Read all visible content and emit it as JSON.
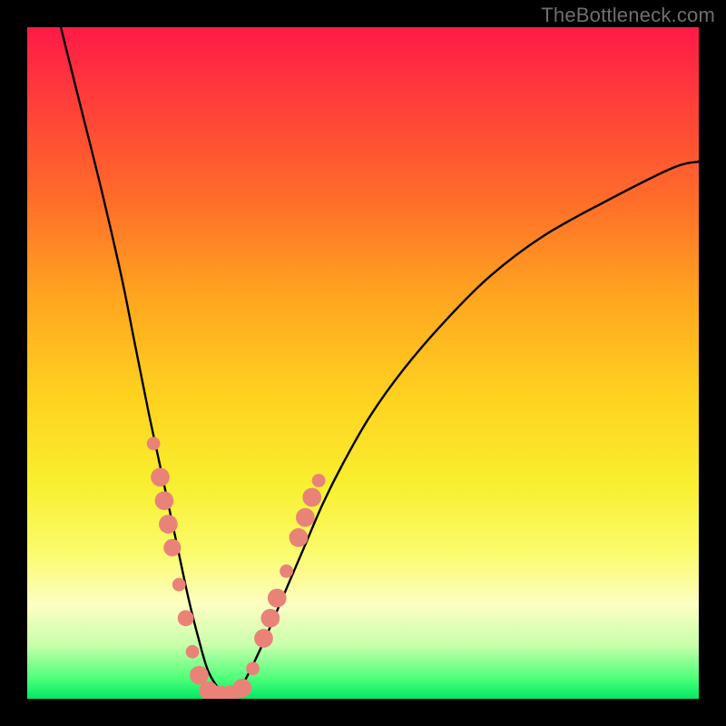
{
  "watermark": {
    "text": "TheBottleneck.com"
  },
  "colors": {
    "background": "#000000",
    "curve": "#000000",
    "marker_fill": "#e98378",
    "marker_stroke": "#cf5b4e"
  },
  "chart_data": {
    "type": "line",
    "title": "",
    "xlabel": "",
    "ylabel": "",
    "xlim": [
      0,
      100
    ],
    "ylim": [
      0,
      100
    ],
    "grid": false,
    "note": "Axes are unlabeled in the source; x is normalized position across the plot, y is percent-of-height of the curve from the bottom. Values are read from pixel positions.",
    "series": [
      {
        "name": "curve",
        "x": [
          5,
          8,
          11,
          14,
          16,
          18,
          19.5,
          21,
          22.5,
          24,
          25.5,
          27,
          29,
          30.5,
          32,
          35,
          38,
          41,
          44,
          47,
          51,
          56,
          62,
          69,
          77,
          86,
          96,
          100
        ],
        "y": [
          100,
          88,
          76,
          63,
          53,
          43,
          36,
          29,
          22,
          15,
          9,
          4,
          1,
          0.5,
          2,
          8,
          15,
          22,
          29,
          35,
          42,
          49,
          56,
          63,
          69,
          74,
          79,
          80
        ]
      }
    ],
    "markers": {
      "name": "dots",
      "note": "Salmon circular markers clustered near the valley of the curve; sizes in plot-width percent.",
      "points": [
        {
          "x": 18.8,
          "y": 38.0,
          "r": 1.0
        },
        {
          "x": 19.8,
          "y": 33.0,
          "r": 1.4
        },
        {
          "x": 20.4,
          "y": 29.5,
          "r": 1.4
        },
        {
          "x": 21.0,
          "y": 26.0,
          "r": 1.4
        },
        {
          "x": 21.6,
          "y": 22.5,
          "r": 1.3
        },
        {
          "x": 22.6,
          "y": 17.0,
          "r": 1.0
        },
        {
          "x": 23.6,
          "y": 12.0,
          "r": 1.2
        },
        {
          "x": 24.6,
          "y": 7.0,
          "r": 1.0
        },
        {
          "x": 25.6,
          "y": 3.5,
          "r": 1.4
        },
        {
          "x": 27.0,
          "y": 1.2,
          "r": 1.4
        },
        {
          "x": 28.6,
          "y": 0.6,
          "r": 1.4
        },
        {
          "x": 30.2,
          "y": 0.6,
          "r": 1.4
        },
        {
          "x": 32.0,
          "y": 1.6,
          "r": 1.4
        },
        {
          "x": 33.6,
          "y": 4.5,
          "r": 1.0
        },
        {
          "x": 35.2,
          "y": 9.0,
          "r": 1.4
        },
        {
          "x": 36.2,
          "y": 12.0,
          "r": 1.4
        },
        {
          "x": 37.2,
          "y": 15.0,
          "r": 1.4
        },
        {
          "x": 38.6,
          "y": 19.0,
          "r": 1.0
        },
        {
          "x": 40.4,
          "y": 24.0,
          "r": 1.4
        },
        {
          "x": 41.4,
          "y": 27.0,
          "r": 1.4
        },
        {
          "x": 42.4,
          "y": 30.0,
          "r": 1.4
        },
        {
          "x": 43.4,
          "y": 32.5,
          "r": 1.0
        }
      ]
    }
  }
}
